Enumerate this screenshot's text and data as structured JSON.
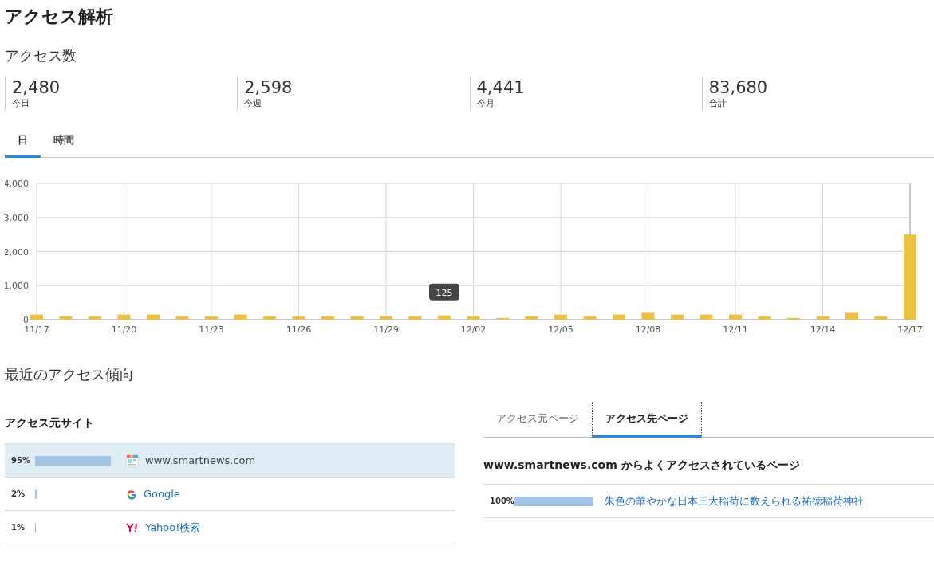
{
  "page_title": "アクセス解析",
  "access_count": {
    "heading": "アクセス数",
    "stats": [
      {
        "value": "2,480",
        "label": "今日"
      },
      {
        "value": "2,598",
        "label": "今週"
      },
      {
        "value": "4,441",
        "label": "今月"
      },
      {
        "value": "83,680",
        "label": "合計"
      }
    ]
  },
  "tabs": [
    {
      "label": "日",
      "selected": true
    },
    {
      "label": "時間",
      "selected": false
    }
  ],
  "chart_data": {
    "type": "bar",
    "categories": [
      "11/17",
      null,
      null,
      "11/20",
      null,
      null,
      "11/23",
      null,
      null,
      "11/26",
      null,
      null,
      "11/29",
      null,
      null,
      "12/02",
      null,
      null,
      "12/05",
      null,
      null,
      "12/08",
      null,
      null,
      "12/11",
      null,
      null,
      "12/14",
      null,
      null,
      "12/17"
    ],
    "series": [
      {
        "color": "#ecc140",
        "values": [
          150,
          100,
          100,
          150,
          150,
          100,
          100,
          150,
          100,
          100,
          100,
          100,
          100,
          100,
          125,
          100,
          50,
          100,
          150,
          100,
          150,
          200,
          150,
          150,
          150,
          100,
          50,
          100,
          200,
          100,
          2500
        ]
      }
    ],
    "grid": true,
    "ylim": [
      0,
      4000
    ],
    "yticks": [
      {
        "value": 0,
        "label": "0"
      },
      {
        "value": 1000,
        "label": "1,000"
      },
      {
        "value": 2000,
        "label": "2,000"
      },
      {
        "value": 3000,
        "label": "3,000"
      },
      {
        "value": 4000,
        "label": "4,000"
      }
    ],
    "annotations": [
      {
        "y": 125,
        "text": "125"
      }
    ]
  },
  "recent": {
    "heading": "最近のアクセス傾向",
    "referrers": {
      "heading": "アクセス元サイト",
      "rows": [
        {
          "percent": "95%",
          "level": 0.95,
          "site": "www.smartnews.com",
          "kind": "news",
          "selected": true
        },
        {
          "percent": "2%",
          "level": 0.02,
          "site": "Google",
          "kind": "google",
          "selected": false
        },
        {
          "percent": "1%",
          "level": 0.01,
          "site": "Yahoo!検索",
          "kind": "yahoo",
          "selected": false
        }
      ]
    },
    "page_tabs": [
      {
        "label": "アクセス元ページ",
        "selected": false
      },
      {
        "label": "アクセス先ページ",
        "selected": true
      }
    ],
    "pages": {
      "heading": "www.smartnews.com からよくアクセスされているページ",
      "rows": [
        {
          "percent": "100%",
          "level": 1.0,
          "title": "朱色の華やかな日本三大稲荷に数えられる祐徳稲荷神社"
        }
      ]
    }
  }
}
